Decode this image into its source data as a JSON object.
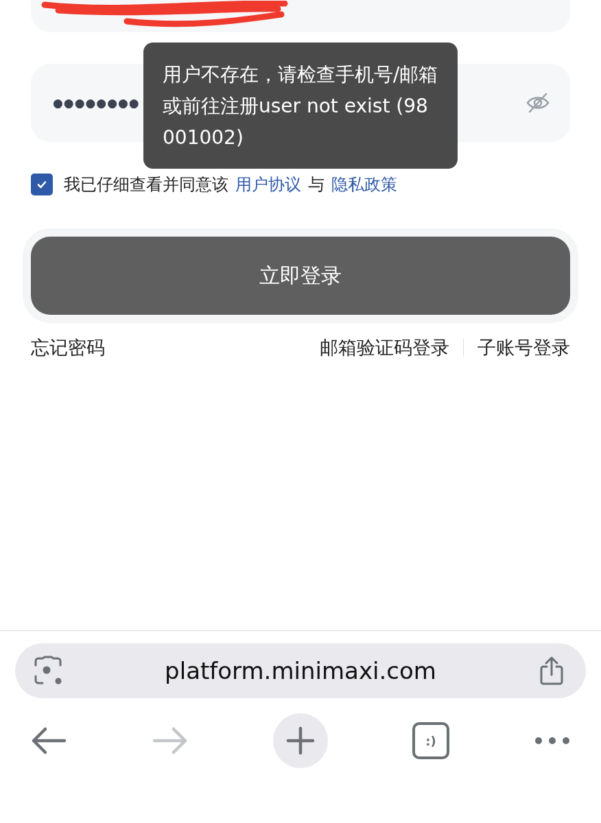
{
  "password_field": {
    "value": "●●●●●●●●"
  },
  "toast": {
    "message": "用户不存在，请检查手机号/邮箱或前往注册user not exist (98001002)"
  },
  "agreement": {
    "checked": true,
    "text": "我已仔细查看并同意该",
    "link_1": "用户协议",
    "joiner": "与",
    "link_2": "隐私政策"
  },
  "login_button": {
    "label": "立即登录"
  },
  "links": {
    "forgot": "忘记密码",
    "email_code": "邮箱验证码登录",
    "sub_account": "子账号登录"
  },
  "browser": {
    "url": "platform.minimaxi.com",
    "tabs_label": ":)",
    "nav": [
      {
        "kind": "back",
        "disabled": false
      },
      {
        "kind": "forward",
        "disabled": true
      },
      {
        "kind": "new-tab",
        "disabled": false
      },
      {
        "kind": "tabs",
        "disabled": false
      },
      {
        "kind": "more",
        "disabled": false
      }
    ]
  }
}
